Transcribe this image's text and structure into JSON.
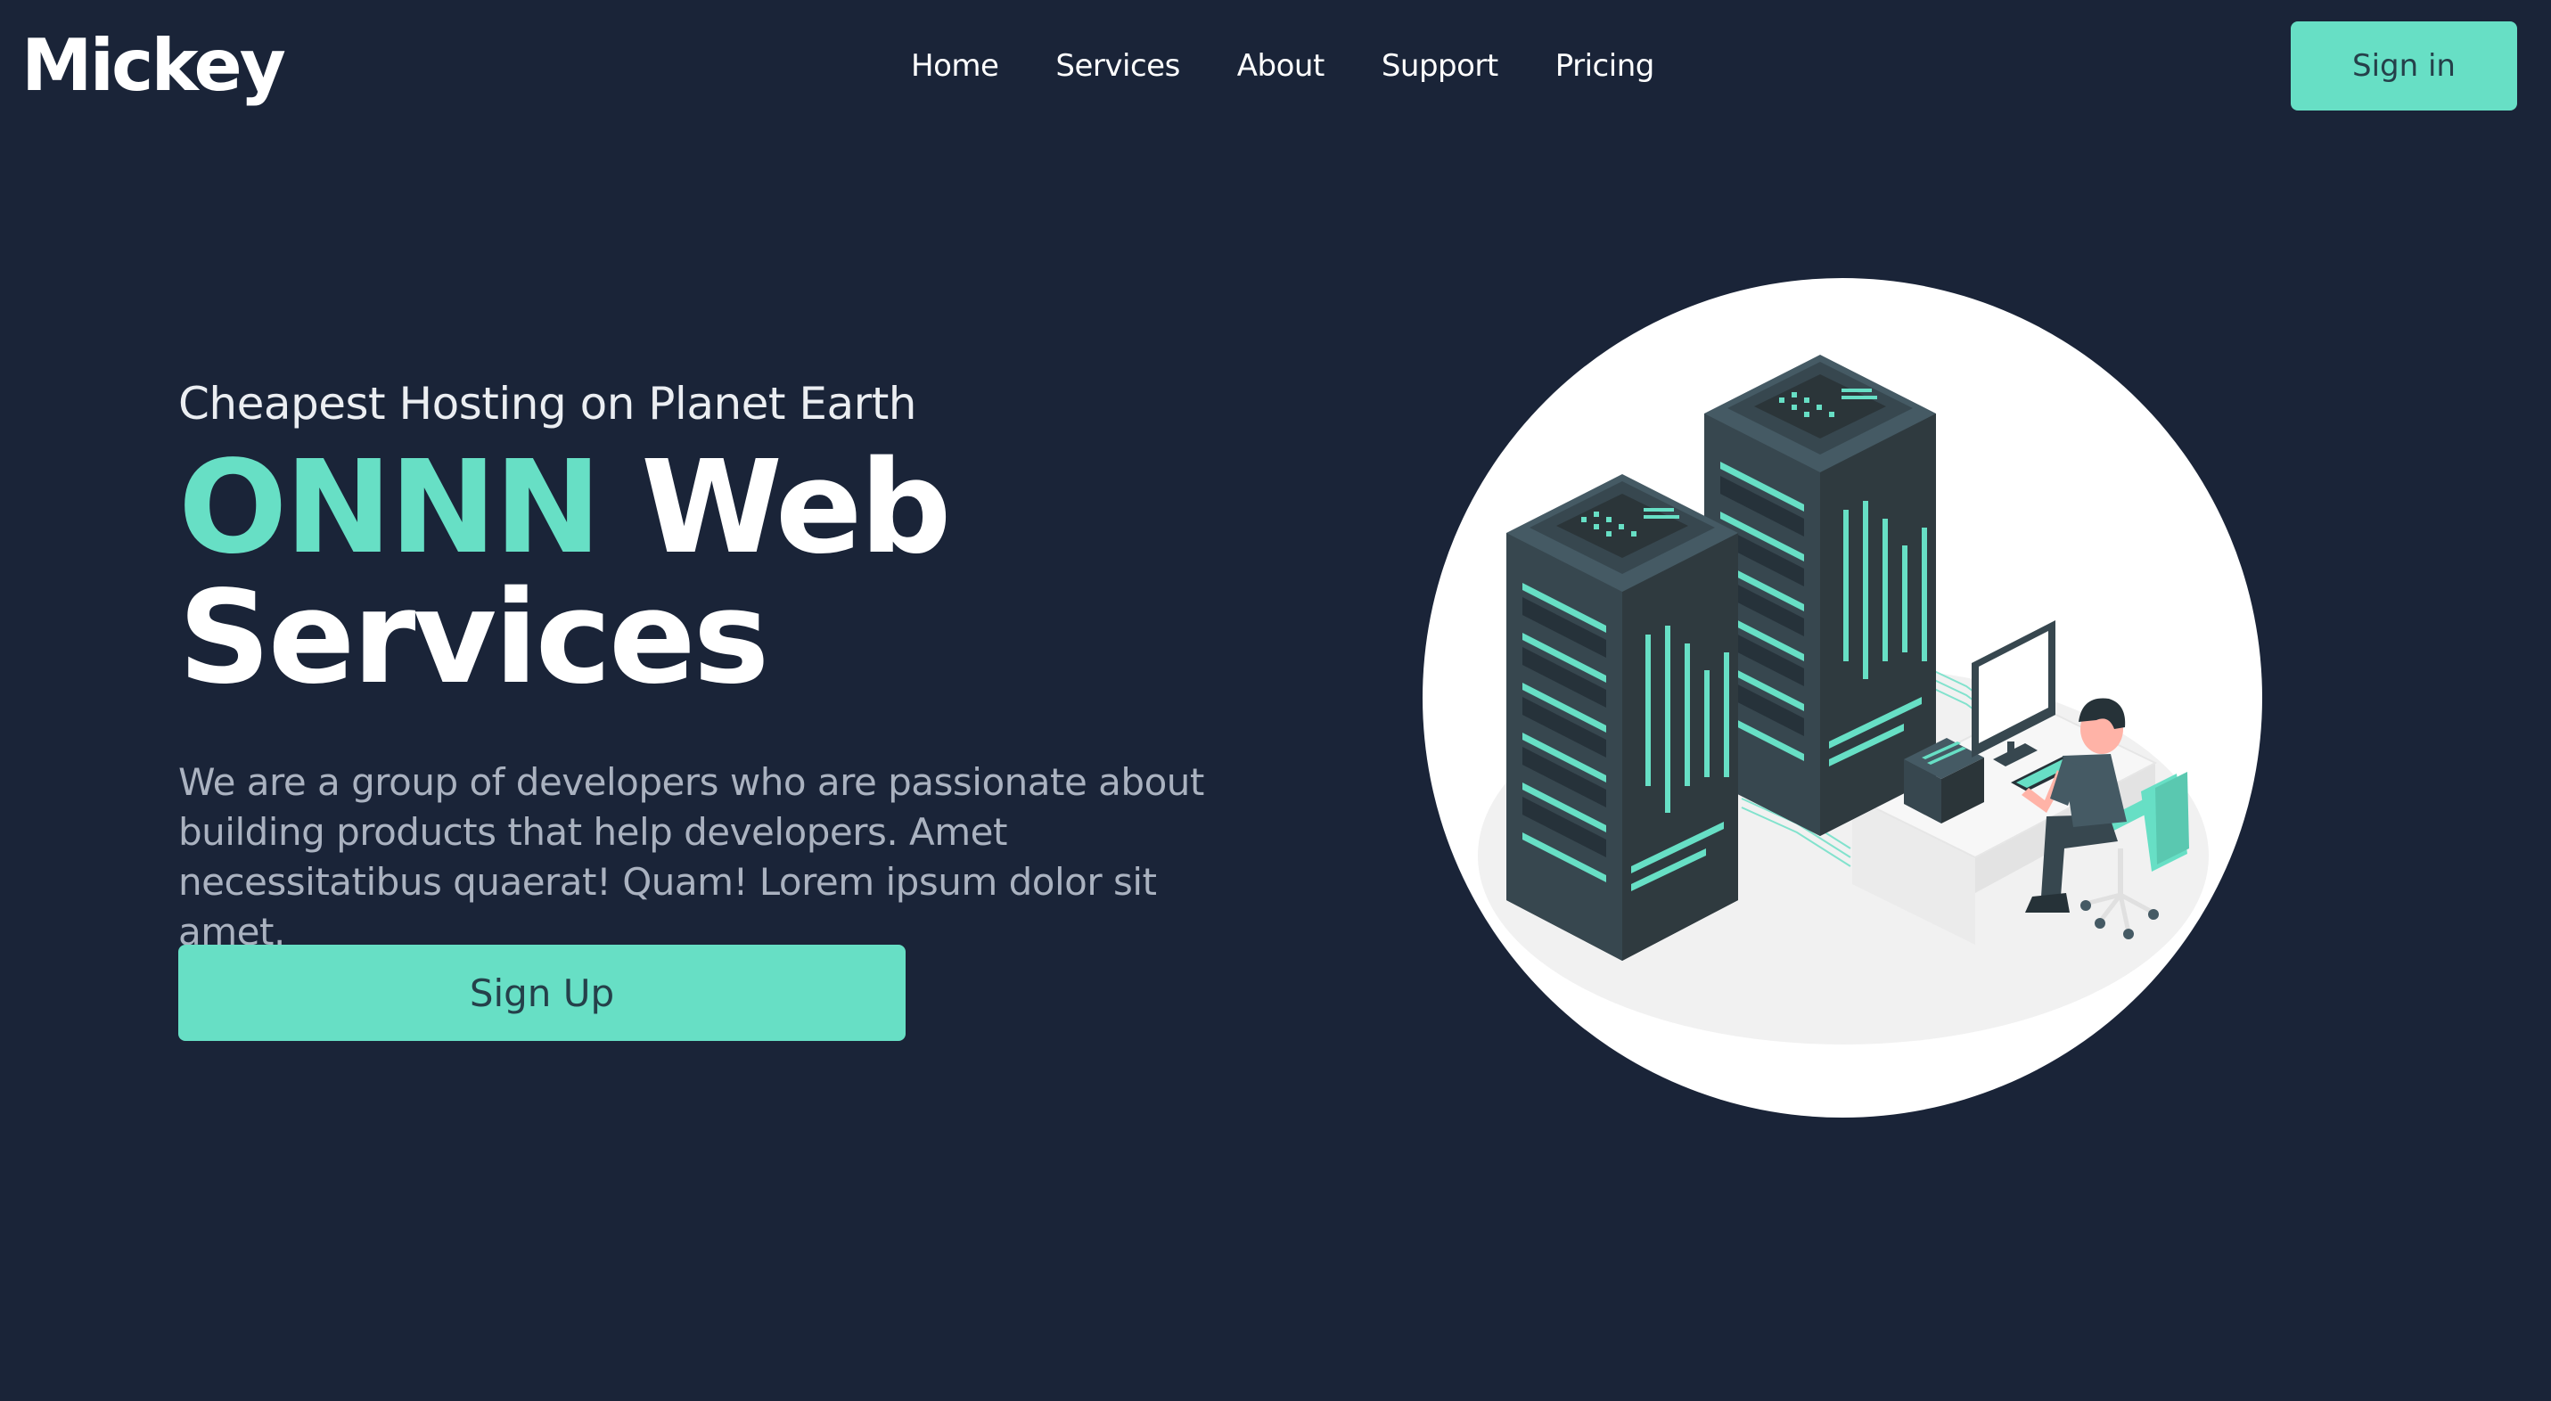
{
  "header": {
    "logo": "Mickey",
    "nav": [
      "Home",
      "Services",
      "About",
      "Support",
      "Pricing"
    ],
    "signin_label": "Sign in"
  },
  "hero": {
    "tagline": "Cheapest Hosting on Planet Earth",
    "headline_accent": "ONNN",
    "headline_rest_1": "Web",
    "headline_rest_2": "Services",
    "description": "We are a group of developers who are passionate about building products that help developers. Amet necessitatibus quaerat! Quam! Lorem ipsum dolor sit amet.",
    "signup_label": "Sign Up"
  },
  "illustration": {
    "icon": "server-room-illustration"
  },
  "colors": {
    "background": "#1a2438",
    "accent": "#67dfc5",
    "button_text": "#25404a",
    "body_text": "#aab2c0"
  }
}
